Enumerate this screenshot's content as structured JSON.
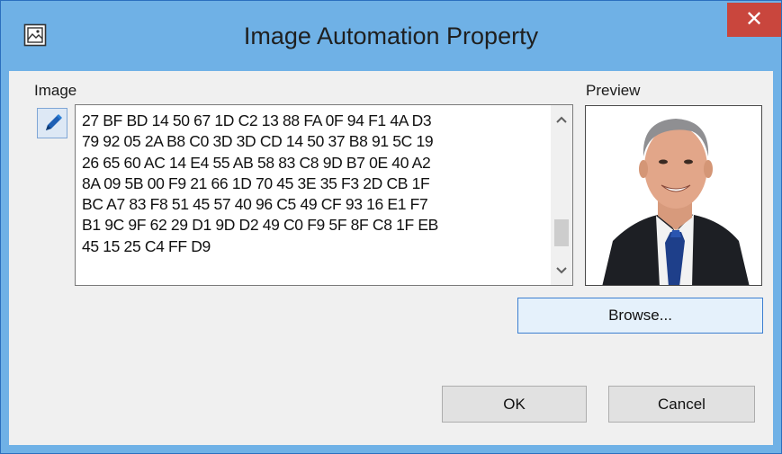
{
  "window": {
    "title": "Image Automation Property",
    "close_glyph": "✕",
    "app_icon": "image-icon"
  },
  "image_section": {
    "label": "Image",
    "edit_icon": "pencil-icon",
    "hex_data": "27 BF BD 14 50 67 1D C2 13 88 FA 0F 94 F1 4A D3\n79 92 05 2A B8 C0 3D 3D CD 14 50 37 B8 91 5C 19\n26 65 60 AC 14 E4 55 AB 58 83 C8 9D B7 0E 40 A2\n8A 09 5B 00 F9 21 66 1D 70 45 3E 35 F3 2D CB 1F\nBC A7 83 F8 51 45 57 40 96 C5 49 CF 93 16 E1 F7\nB1 9C 9F 62 29 D1 9D D2 49 C0 F9 5F 8F C8 1F EB\n45 15 25 C4 FF D9"
  },
  "preview_section": {
    "label": "Preview"
  },
  "buttons": {
    "browse": "Browse...",
    "ok": "OK",
    "cancel": "Cancel"
  },
  "colors": {
    "titlebar": "#6fb1e6",
    "close": "#c9463d",
    "dialog_bg": "#f0f0f0",
    "focus_border": "#3c7fd1"
  }
}
